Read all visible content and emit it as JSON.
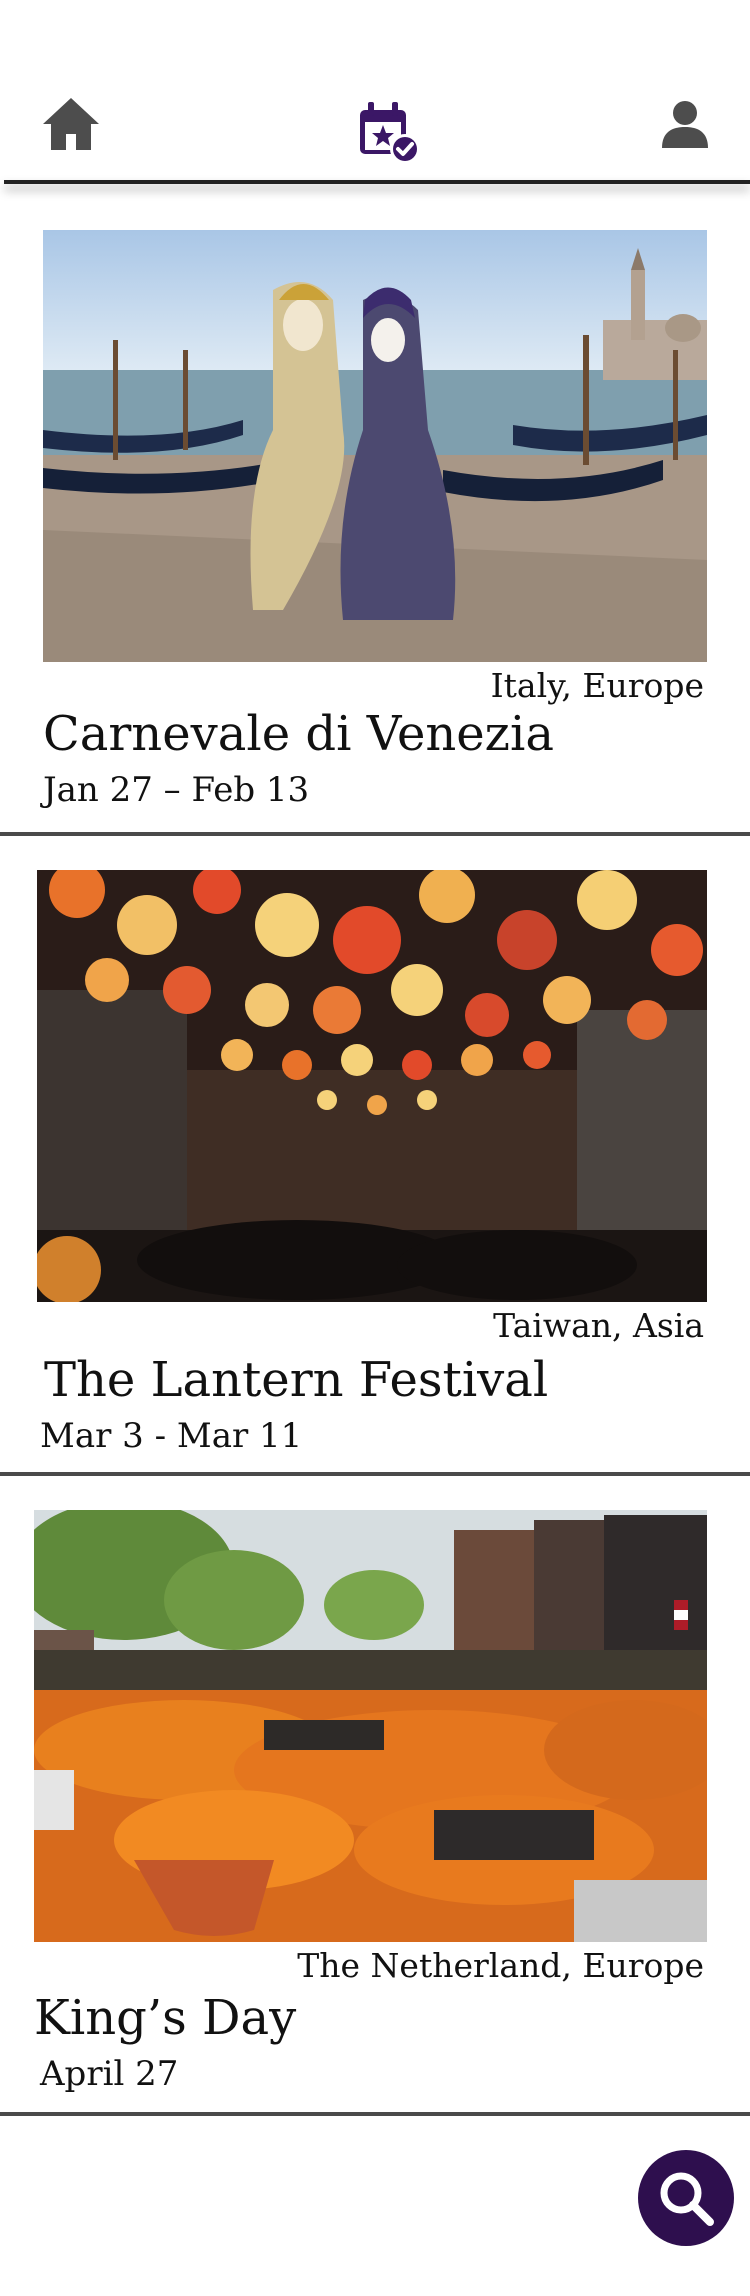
{
  "nav": {
    "home_icon": "home-icon",
    "events_icon": "calendar-check-icon",
    "profile_icon": "person-icon",
    "active_color": "#3b1766",
    "inactive_color": "#4d4d4d"
  },
  "events": [
    {
      "location": "Italy, Europe",
      "title": "Carnevale di Venezia",
      "dates": "Jan 27 – Feb 13"
    },
    {
      "location": "Taiwan, Asia",
      "title": "The Lantern Festival",
      "dates": "Mar 3 - Mar 11"
    },
    {
      "location": "The Netherland, Europe",
      "title": "King’s Day",
      "dates": "April 27"
    }
  ],
  "search": {
    "icon": "search-icon",
    "color": "#2e0f4e"
  }
}
